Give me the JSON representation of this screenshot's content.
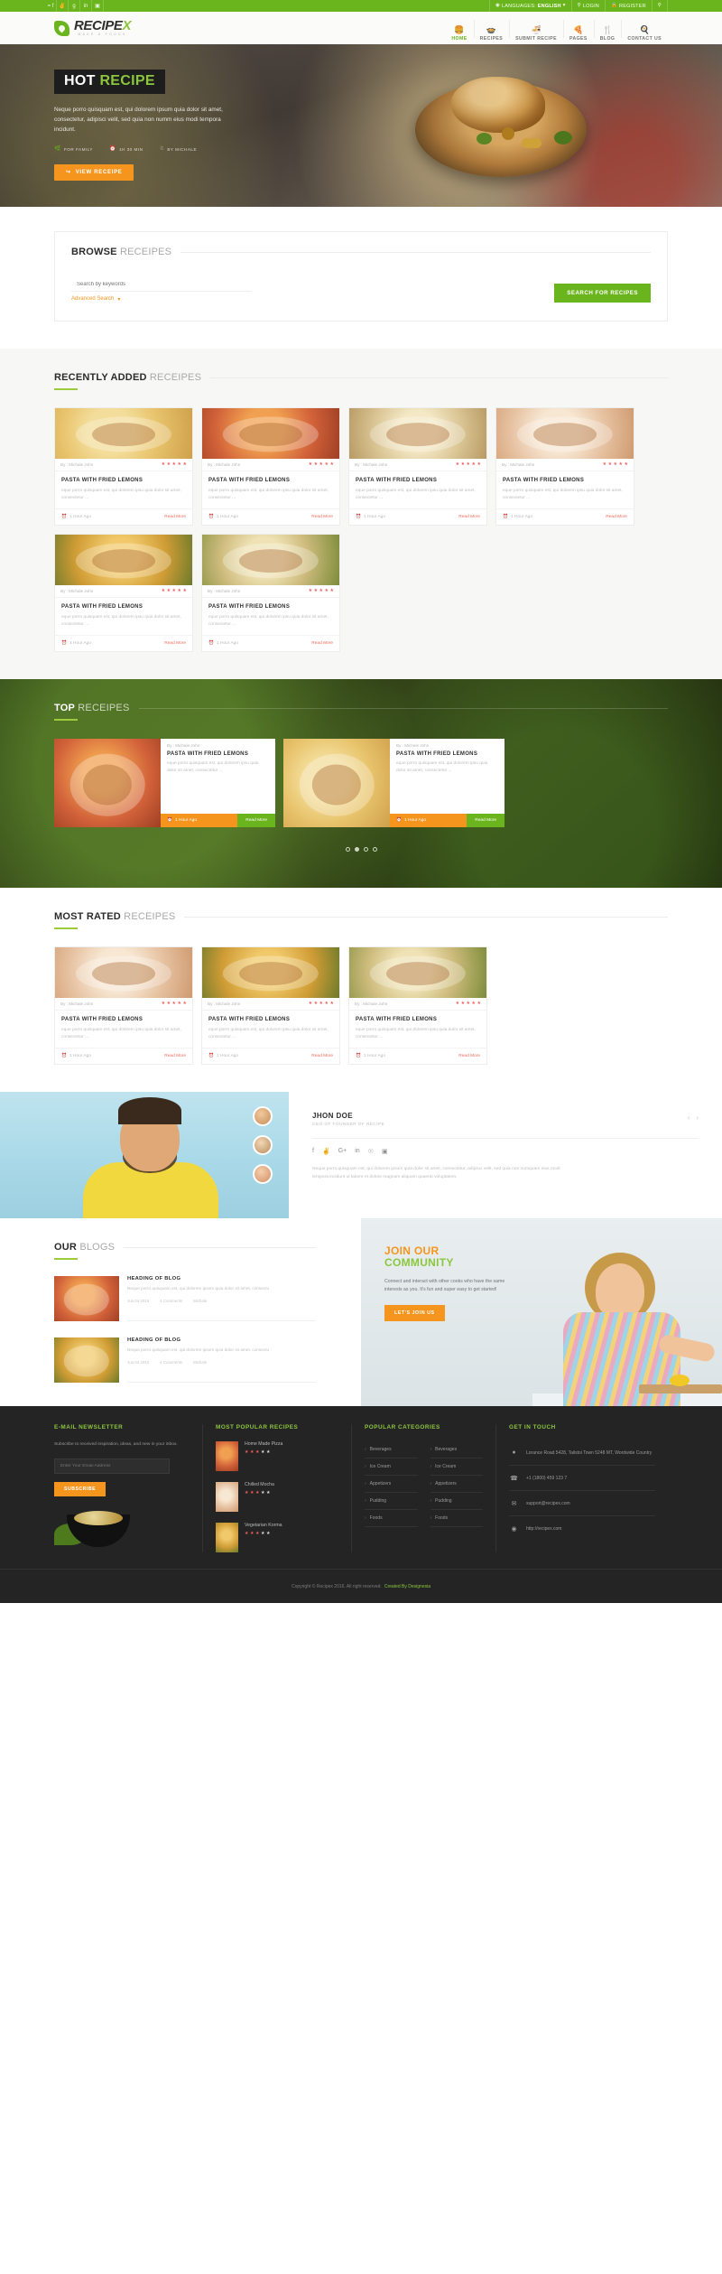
{
  "topbar": {
    "social": [
      "facebook-icon",
      "twitter-icon",
      "google-plus-icon",
      "linkedin-icon",
      "instagram-icon"
    ],
    "language_label": "LANGUAGES:",
    "language_value": "ENGLISH",
    "login": "LOGIN",
    "register": "REGISTER",
    "search_icon": "search-icon"
  },
  "brand": {
    "name_main": "RECIPE",
    "name_accent": "X",
    "tagline": "MAKE A FOODS"
  },
  "nav": [
    {
      "label": "HOME",
      "icon": "burger-icon",
      "active": true
    },
    {
      "label": "RECIPES",
      "icon": "pan-icon",
      "active": false
    },
    {
      "label": "SUBMIT RECIPE",
      "icon": "bowl-icon",
      "active": false
    },
    {
      "label": "PAGES",
      "icon": "pizza-icon",
      "active": false
    },
    {
      "label": "BLOG",
      "icon": "cutlery-icon",
      "active": false
    },
    {
      "label": "CONTACT US",
      "icon": "chef-hat-icon",
      "active": false
    }
  ],
  "hero": {
    "title_a": "HOT",
    "title_b": "RECIPE",
    "description": "Neque porro quisquam est, qui dolorem ipsum quia dolor sit amet, consectetur, adipisci velit, sed quia non numm eius modi tempora incidunt.",
    "meta": [
      {
        "icon": "leaf-icon",
        "text": "FOR FAMILY"
      },
      {
        "icon": "clock-icon",
        "text": "1H 30 MIN"
      },
      {
        "icon": "user-icon",
        "text": "BY MICHALE"
      }
    ],
    "button": "VIEW RECEIPE",
    "button_icon": "arrow-icon"
  },
  "browse": {
    "title_bold": "BROWSE",
    "title_light": "RECEIPES",
    "keyword_placeholder": "Search by keywords",
    "keyword_value": "",
    "advanced": "Advanced Search",
    "advanced_icon": "chevron-down-icon",
    "search_button": "SEARCH FOR RECIPES"
  },
  "recently": {
    "title_bold": "RECENTLY ADDED",
    "title_light": "RECEIPES",
    "cards": [
      {
        "byline": "By : Michale John",
        "rating": 5,
        "title": "PASTA WITH FRIED LEMONS",
        "text": "eque porro quisquam est, qui dolorem ipsu quia dolor sit amet, consectetur ...",
        "time": "1 Hour Ago",
        "more": "Read More",
        "img": "f1"
      },
      {
        "byline": "By : Michale John",
        "rating": 5,
        "title": "PASTA WITH FRIED LEMONS",
        "text": "eque porro quisquam est, qui dolorem ipsu quia dolor sit amet, consectetur ...",
        "time": "1 Hour Ago",
        "more": "Read More",
        "img": "f2"
      },
      {
        "byline": "By : Michale John",
        "rating": 5,
        "title": "PASTA WITH FRIED LEMONS",
        "text": "eque porro quisquam est, qui dolorem ipsu quia dolor sit amet, consectetur ...",
        "time": "1 Hour Ago",
        "more": "Read More",
        "img": "f3"
      },
      {
        "byline": "By : Michale John",
        "rating": 5,
        "title": "PASTA WITH FRIED LEMONS",
        "text": "eque porro quisquam est, qui dolorem ipsu quia dolor sit amet, consectetur ...",
        "time": "1 Hour Ago",
        "more": "Read More",
        "img": "f4"
      },
      {
        "byline": "By : Michale John",
        "rating": 5,
        "title": "PASTA WITH FRIED LEMONS",
        "text": "eque porro quisquam est, qui dolorem ipsu quia dolor sit amet, consectetur ...",
        "time": "1 Hour Ago",
        "more": "Read More",
        "img": "f5"
      },
      {
        "byline": "By : Michale John",
        "rating": 5,
        "title": "PASTA WITH FRIED LEMONS",
        "text": "eque porro quisquam est, qui dolorem ipsu quia dolor sit amet, consectetur ...",
        "time": "1 Hour Ago",
        "more": "Read More",
        "img": "f6"
      }
    ]
  },
  "top": {
    "title_bold": "TOP",
    "title_light": "RECEIPES",
    "cards": [
      {
        "byline": "By : Michale John",
        "rating": 5,
        "title": "PASTA WITH FRIED LEMONS",
        "text": "eque porro quisquam est, qui dolorem ipsu quia dolor sit amet, consectetur ...",
        "time": "1 Hour Ago",
        "more": "Read More",
        "img": "f2"
      },
      {
        "byline": "By : Michale John",
        "rating": 5,
        "title": "PASTA WITH FRIED LEMONS",
        "text": "eque porro quisquam est, qui dolorem ipsu quia dolor sit amet, consectetur ...",
        "time": "1 Hour Ago",
        "more": "Read More",
        "img": "f1"
      }
    ],
    "dots": 4,
    "active_dot": 1
  },
  "most_rated": {
    "title_bold": "MOST RATED",
    "title_light": "RECEIPES",
    "cards": [
      {
        "byline": "By : Michale John",
        "rating": 5,
        "title": "PASTA WITH FRIED LEMONS",
        "text": "eque porro quisquam est, qui dolorem ipsu quia dolor sit amet, consectetur ...",
        "time": "1 Hour Ago",
        "more": "Read More",
        "img": "f4"
      },
      {
        "byline": "By : Michale John",
        "rating": 5,
        "title": "PASTA WITH FRIED LEMONS",
        "text": "eque porro quisquam est, qui dolorem ipsu quia dolor sit amet, consectetur ...",
        "time": "1 Hour Ago",
        "more": "Read More",
        "img": "f5"
      },
      {
        "byline": "By : Michale John",
        "rating": 5,
        "title": "PASTA WITH FRIED LEMONS",
        "text": "eque porro quisquam est, qui dolorem ipsu quia dolor sit amet, consectetur ...",
        "time": "1 Hour Ago",
        "more": "Read More",
        "img": "f6"
      }
    ]
  },
  "chef": {
    "name": "JHON DOE",
    "role": "CEO OF FOUNDER OF RECIPE",
    "socials": [
      "facebook-icon",
      "twitter-icon",
      "google-plus-icon",
      "linkedin-icon",
      "pinterest-icon",
      "instagram-icon"
    ],
    "quote": "Neque porro quisquam est, qui dolorem ipsum quia dolor sit amet, consectetur, adipisci velit, sed quia non numquam eius modi tempora incidunt ut labore et dolore magnam aliquam quaerat voluptatem.",
    "prev_icon": "chevron-left-icon",
    "next_icon": "chevron-right-icon"
  },
  "blogs": {
    "title_bold": "OUR",
    "title_light": "BLOGS",
    "items": [
      {
        "title": "HEADING OF BLOG",
        "text": "Neque porro quisquam est, qui dolorem ipsum quia dolor sit amet, consectu",
        "date": "Jun 04 2016",
        "comments": "4 Comments",
        "author": "Michale",
        "img": "f2"
      },
      {
        "title": "HEADING OF BLOG",
        "text": "Neque porro quisquam est, qui dolorem ipsum quia dolor sit amet, consectu",
        "date": "Jun 04 2016",
        "comments": "4 Comments",
        "author": "Michale",
        "img": "f5"
      }
    ]
  },
  "community": {
    "title_a": "JOIN OUR",
    "title_b": "COMMUNITY",
    "text": "Connect and interact with other cooks who have the same interests as you. It's fun and super easy to get started!",
    "button": "LET'S JOIN US"
  },
  "footer": {
    "newsletter": {
      "heading": "E-MAIL NEWSLETTER",
      "text": "Subscribe to received inspiration, ideas, and new in your inbox.",
      "placeholder": "Enter Your Email Address",
      "value": "",
      "button": "SUBSCRIBE"
    },
    "popular": {
      "heading": "MOST POPULAR RECIPES",
      "items": [
        {
          "name": "Home Made Pizza",
          "rating": 3,
          "img": "f2"
        },
        {
          "name": "Chilled Mocha",
          "rating": 3,
          "img": "f4"
        },
        {
          "name": "Vegetarian Korma",
          "rating": 3,
          "img": "f5"
        }
      ]
    },
    "categories": {
      "heading": "POPULAR CATEGORIES",
      "col1": [
        "Beverages",
        "Ice Cream",
        "Appetizers",
        "Pudding",
        "Foods"
      ],
      "col2": [
        "Beverages",
        "Ice Cream",
        "Appetizers",
        "Pudding",
        "Foods"
      ]
    },
    "contact": {
      "heading": "GET IN TOUCH",
      "items": [
        {
          "icon": "location-icon",
          "text": "Lorance Road 5428, Tailstoi Town 5248 MT, Wordwide Country"
        },
        {
          "icon": "phone-icon",
          "text": "+1 (1800) 459 123 7"
        },
        {
          "icon": "mail-icon",
          "text": "support@recipex.com"
        },
        {
          "icon": "globe-icon",
          "text": "http://recipex.com"
        }
      ]
    },
    "copyright_text": "Copyright © Recipex 2016. All right reserved.",
    "copyright_link": "Created By Designesia"
  }
}
